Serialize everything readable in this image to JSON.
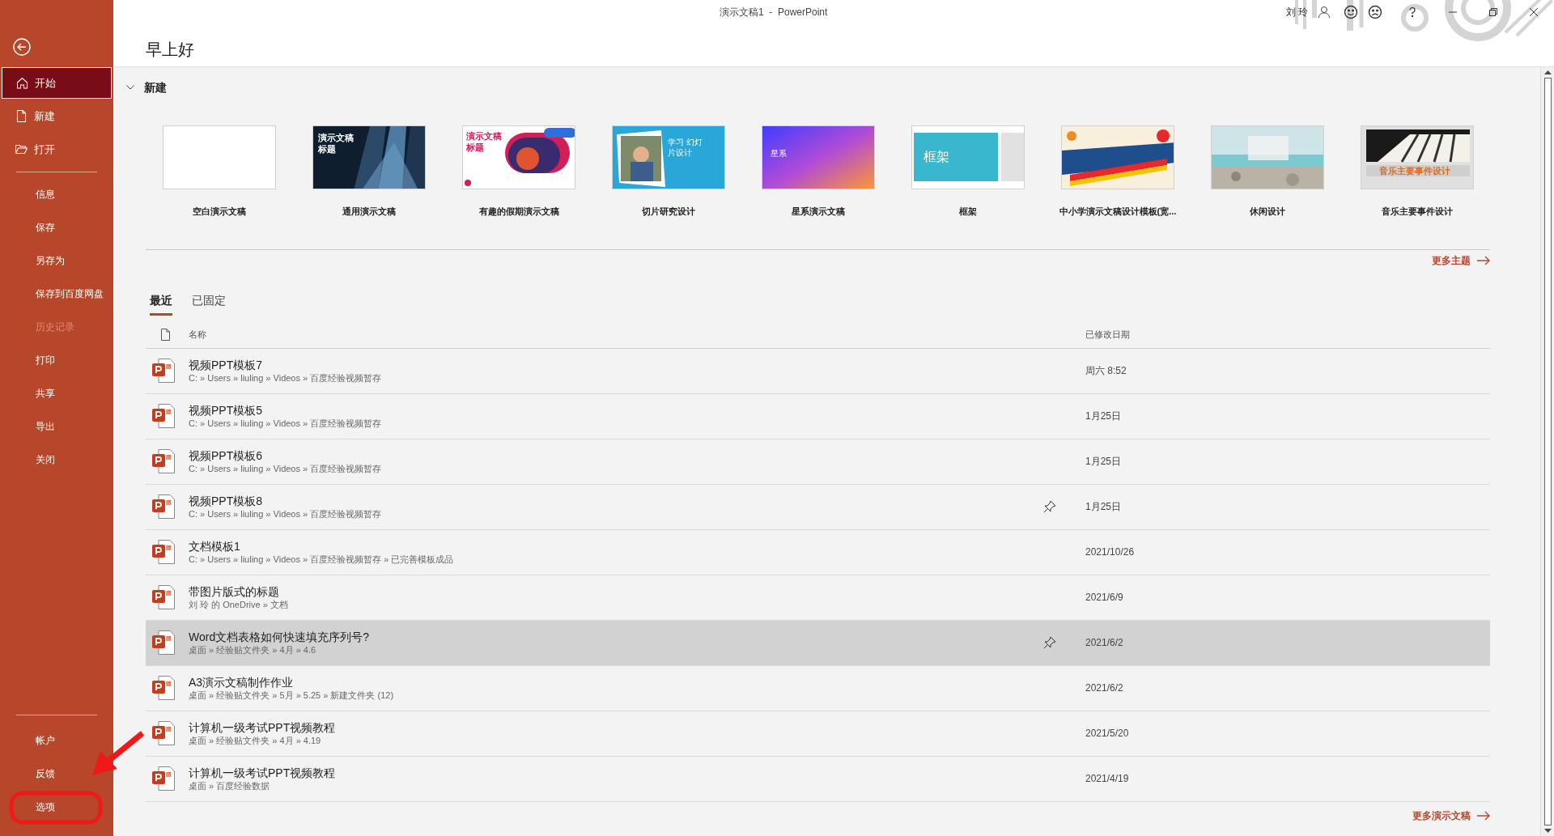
{
  "window": {
    "title": "演示文稿1  -  PowerPoint",
    "user": "刘 玲"
  },
  "sidebar": {
    "top": [
      {
        "label": "开始",
        "kind": "home",
        "selected": true
      },
      {
        "label": "新建",
        "kind": "new",
        "selected": false
      },
      {
        "label": "打开",
        "kind": "open",
        "selected": false
      }
    ],
    "items": [
      {
        "label": "信息",
        "disabled": false
      },
      {
        "label": "保存",
        "disabled": false
      },
      {
        "label": "另存为",
        "disabled": false
      },
      {
        "label": "保存到百度网盘",
        "disabled": false
      },
      {
        "label": "历史记录",
        "disabled": true
      },
      {
        "label": "打印",
        "disabled": false
      },
      {
        "label": "共享",
        "disabled": false
      },
      {
        "label": "导出",
        "disabled": false
      },
      {
        "label": "关闭",
        "disabled": false
      }
    ],
    "bottom": [
      {
        "label": "帐户"
      },
      {
        "label": "反馈"
      },
      {
        "label": "选项"
      }
    ]
  },
  "greeting": "早上好",
  "new_section": {
    "title": "新建",
    "expanded": true,
    "more": "更多主题",
    "templates": [
      {
        "label": "空白演示文稿",
        "kind": "blank"
      },
      {
        "label": "通用演示文稿",
        "kind": "city",
        "thumb_title": "演示文稿标题"
      },
      {
        "label": "有趣的假期演示文稿",
        "kind": "vacation",
        "thumb_title": "演示文稿标题"
      },
      {
        "label": "切片研究设计",
        "kind": "classroom",
        "thumb_title": "学习 幻灯片设计"
      },
      {
        "label": "星系演示文稿",
        "kind": "gradient",
        "thumb_title": "星系"
      },
      {
        "label": "框架",
        "kind": "frame",
        "thumb_title": "框架"
      },
      {
        "label": "中小学演示文稿设计模板(宽...",
        "kind": "ribbon"
      },
      {
        "label": "休闲设计",
        "kind": "beach"
      },
      {
        "label": "音乐主要事件设计",
        "kind": "piano",
        "thumb_title": "音乐主要事件设计"
      }
    ]
  },
  "tabs": [
    {
      "label": "最近",
      "selected": true
    },
    {
      "label": "已固定",
      "selected": false
    }
  ],
  "table": {
    "columns": [
      "名称",
      "已修改日期"
    ],
    "rows": [
      {
        "name": "视频PPT模板7",
        "path": "C: » Users » liuling » Videos » 百度经验视频暂存",
        "date": "周六 8:52",
        "pin_shown": false,
        "selected": false
      },
      {
        "name": "视频PPT模板5",
        "path": "C: » Users » liuling » Videos » 百度经验视频暂存",
        "date": "1月25日",
        "pin_shown": false,
        "selected": false
      },
      {
        "name": "视频PPT模板6",
        "path": "C: » Users » liuling » Videos » 百度经验视频暂存",
        "date": "1月25日",
        "pin_shown": false,
        "selected": false
      },
      {
        "name": "视频PPT模板8",
        "path": "C: » Users » liuling » Videos » 百度经验视频暂存",
        "date": "1月25日",
        "pin_shown": true,
        "selected": false
      },
      {
        "name": "文档模板1",
        "path": "C: » Users » liuling » Videos » 百度经验视频暂存 » 已完善模板成品",
        "date": "2021/10/26",
        "pin_shown": false,
        "selected": false
      },
      {
        "name": "带图片版式的标题",
        "path": "刘 玲 的 OneDrive » 文档",
        "date": "2021/6/9",
        "pin_shown": false,
        "selected": false
      },
      {
        "name": "Word文档表格如何快速填充序列号?",
        "path": "桌面 » 经验贴文件夹 » 4月 » 4.6",
        "date": "2021/6/2",
        "pin_shown": true,
        "selected": true
      },
      {
        "name": "A3演示文稿制作作业",
        "path": "桌面 » 经验贴文件夹 » 5月 » 5.25 » 新建文件夹 (12)",
        "date": "2021/6/2",
        "pin_shown": false,
        "selected": false
      },
      {
        "name": "计算机一级考试PPT视频教程",
        "path": "桌面 » 经验贴文件夹 » 4月 » 4.19",
        "date": "2021/5/20",
        "pin_shown": false,
        "selected": false
      },
      {
        "name": "计算机一级考试PPT视频教程",
        "path": "桌面 » 百度经验数据",
        "date": "2021/4/19",
        "pin_shown": false,
        "selected": false
      }
    ],
    "more": "更多演示文稿"
  }
}
